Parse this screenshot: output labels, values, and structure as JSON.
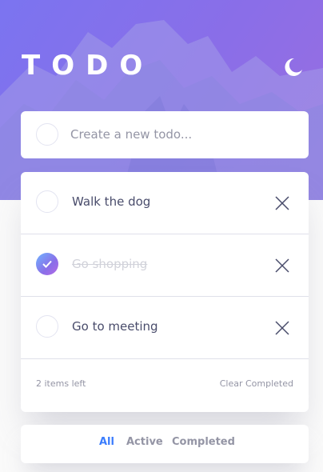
{
  "header": {
    "title": "TODO",
    "theme_icon": "moon-icon"
  },
  "new_todo": {
    "placeholder": "Create a new todo..."
  },
  "todos": [
    {
      "text": "Walk the dog",
      "completed": false
    },
    {
      "text": "Go shopping",
      "completed": true
    },
    {
      "text": "Go to meeting",
      "completed": false
    }
  ],
  "footer": {
    "items_left": "2 items left",
    "clear_completed": "Clear Completed"
  },
  "filters": [
    {
      "label": "All",
      "active": true
    },
    {
      "label": "Active",
      "active": false
    },
    {
      "label": "Completed",
      "active": false
    }
  ],
  "colors": {
    "accent": "#3a7cfd",
    "hero_start": "#7b74f0",
    "hero_end": "#9a6fe0",
    "check_start": "#6fb4ff",
    "check_end": "#b56be6",
    "text": "#494c6b",
    "muted": "#9495a5",
    "done": "#d1d2da"
  }
}
